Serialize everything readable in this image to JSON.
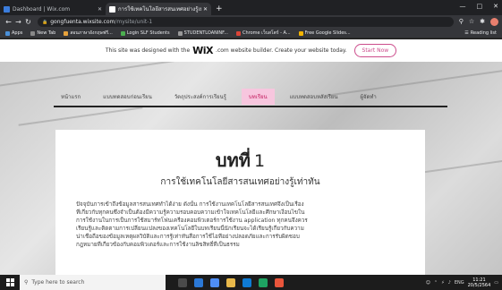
{
  "browser": {
    "tabs": [
      {
        "label": "Dashboard | Wix.com",
        "active": false,
        "favicon_color": "#3b7ddd"
      },
      {
        "label": "การใช้เทคโนโลยีสารสนเทศอย่างรู้เท่าทัน",
        "active": true,
        "favicon_color": "#ffffff"
      }
    ],
    "new_tab": "+",
    "window_controls": [
      "—",
      "□",
      "✕"
    ],
    "url_host": "gongfuenta.wixsite.com",
    "url_path": "/mysite/unit-1",
    "bookmarks": [
      {
        "label": "Apps",
        "color": "#4a90d9"
      },
      {
        "label": "New Tab",
        "color": "#888888"
      },
      {
        "label": "สอนภาษาอังกฤษฟรี...",
        "color": "#e6a23c"
      },
      {
        "label": "Login SLF Students",
        "color": "#4caf50"
      },
      {
        "label": "STUDENTLOANINF...",
        "color": "#999999"
      },
      {
        "label": "Chrome เว็บสโตร์ - A...",
        "color": "#db4437"
      },
      {
        "label": "Free Google Slides...",
        "color": "#f4b400"
      }
    ],
    "reading_list": "Reading list"
  },
  "wix_banner": {
    "text_before": "This site was designed with the",
    "brand": "WiX",
    "text_after": ".com website builder. Create your website today.",
    "button": "Start Now"
  },
  "site": {
    "nav": [
      {
        "label": "หน้าแรก",
        "active": false
      },
      {
        "label": "แบบทดสอบก่อนเรียน",
        "active": false
      },
      {
        "label": "วัตถุประสงค์การเรียนรู้",
        "active": false
      },
      {
        "label": "บทเรียน",
        "active": true
      },
      {
        "label": "แบบทดสอบหลังเรียน",
        "active": false
      },
      {
        "label": "ผู้จัดทำ",
        "active": false
      }
    ],
    "heading_th": "บทที่",
    "heading_num": "1",
    "subheading": "การใช้เทคโนโลยีสารสนเทศอย่างรู้เท่าทัน",
    "body_lines": [
      "ปัจจุบันการเข้าถึงข้อมูลสารสนเทศทำได้ง่าย ดังนั้น การใช้งานเทคโนโลยีสารสนเทศจึงเป็นเรื่อง",
      "ที่เกี่ยวกับทุกคนซึ่งจำเป็นต้องมีความรู้ความรอบคอบความเข้าใจเทคโนโลยีและศึกษาเงื่อนไขใน",
      "การใช้งานในการเป็นการใช้สมาร์ทโฟนเครื่องคอมพิวเตอร์การใช้งาน application ทุกคนจึงควร",
      "เรียนรู้และติดตามการเปลี่ยนแปลงของเทคโนโลยีในบทเรียนนี้นักเรียนจะได้เรียนรู้เกี่ยวกับความ",
      "น่าเชื่อถือของข้อมูลเหตุผลวิบัติและการรู้เท่าทันสื่อการใช้ไอทีอย่างปลอดภัยและการรับผิดชอบ",
      "กฎหมายที่เกี่ยวข้องกับคอมพิวเตอร์และการใช้งานลิขสิทธิ์ที่เป็นธรรม"
    ]
  },
  "taskbar": {
    "search_placeholder": "Type here to search",
    "apps": [
      "#4a4a4a",
      "#2b78d6",
      "#4f8ef5",
      "#e8b84a",
      "#0f7bd4",
      "#1ea362",
      "#e9553b"
    ],
    "lang": "ENG",
    "time": "11:21",
    "date": "20/5/2564"
  }
}
